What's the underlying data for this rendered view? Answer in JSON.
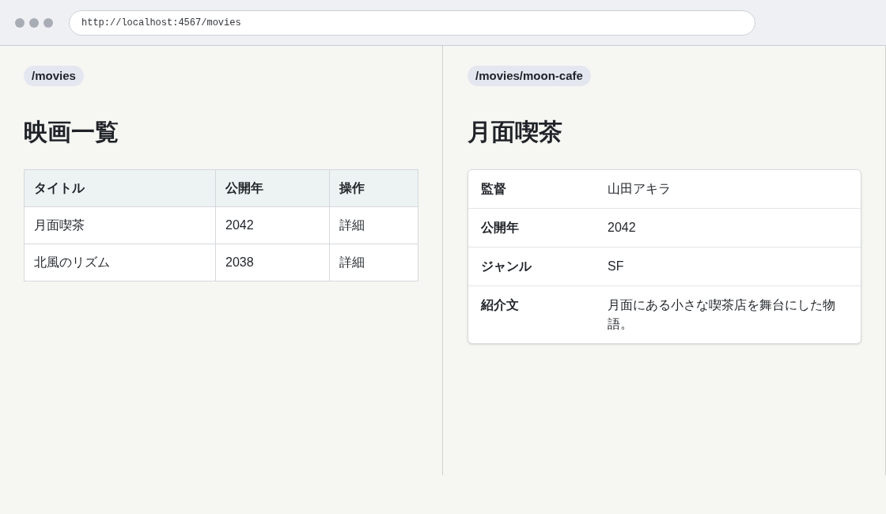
{
  "browser": {
    "url": "http://localhost:4567/movies"
  },
  "list_page": {
    "route": "/movies",
    "heading": "映画一覧",
    "table": {
      "columns": [
        "タイトル",
        "公開年",
        "操作"
      ],
      "rows": [
        [
          "月面喫茶",
          "2042",
          "詳細"
        ],
        [
          "北風のリズム",
          "2038",
          "詳細"
        ]
      ]
    }
  },
  "detail_page": {
    "route": "/movies/moon-cafe",
    "heading": "月面喫茶",
    "fields": [
      {
        "label": "監督",
        "value": "山田アキラ"
      },
      {
        "label": "公開年",
        "value": "2042"
      },
      {
        "label": "ジャンル",
        "value": "SF"
      },
      {
        "label": "紹介文",
        "value": "月面にある小さな喫茶店を舞台にした物語。"
      }
    ]
  }
}
